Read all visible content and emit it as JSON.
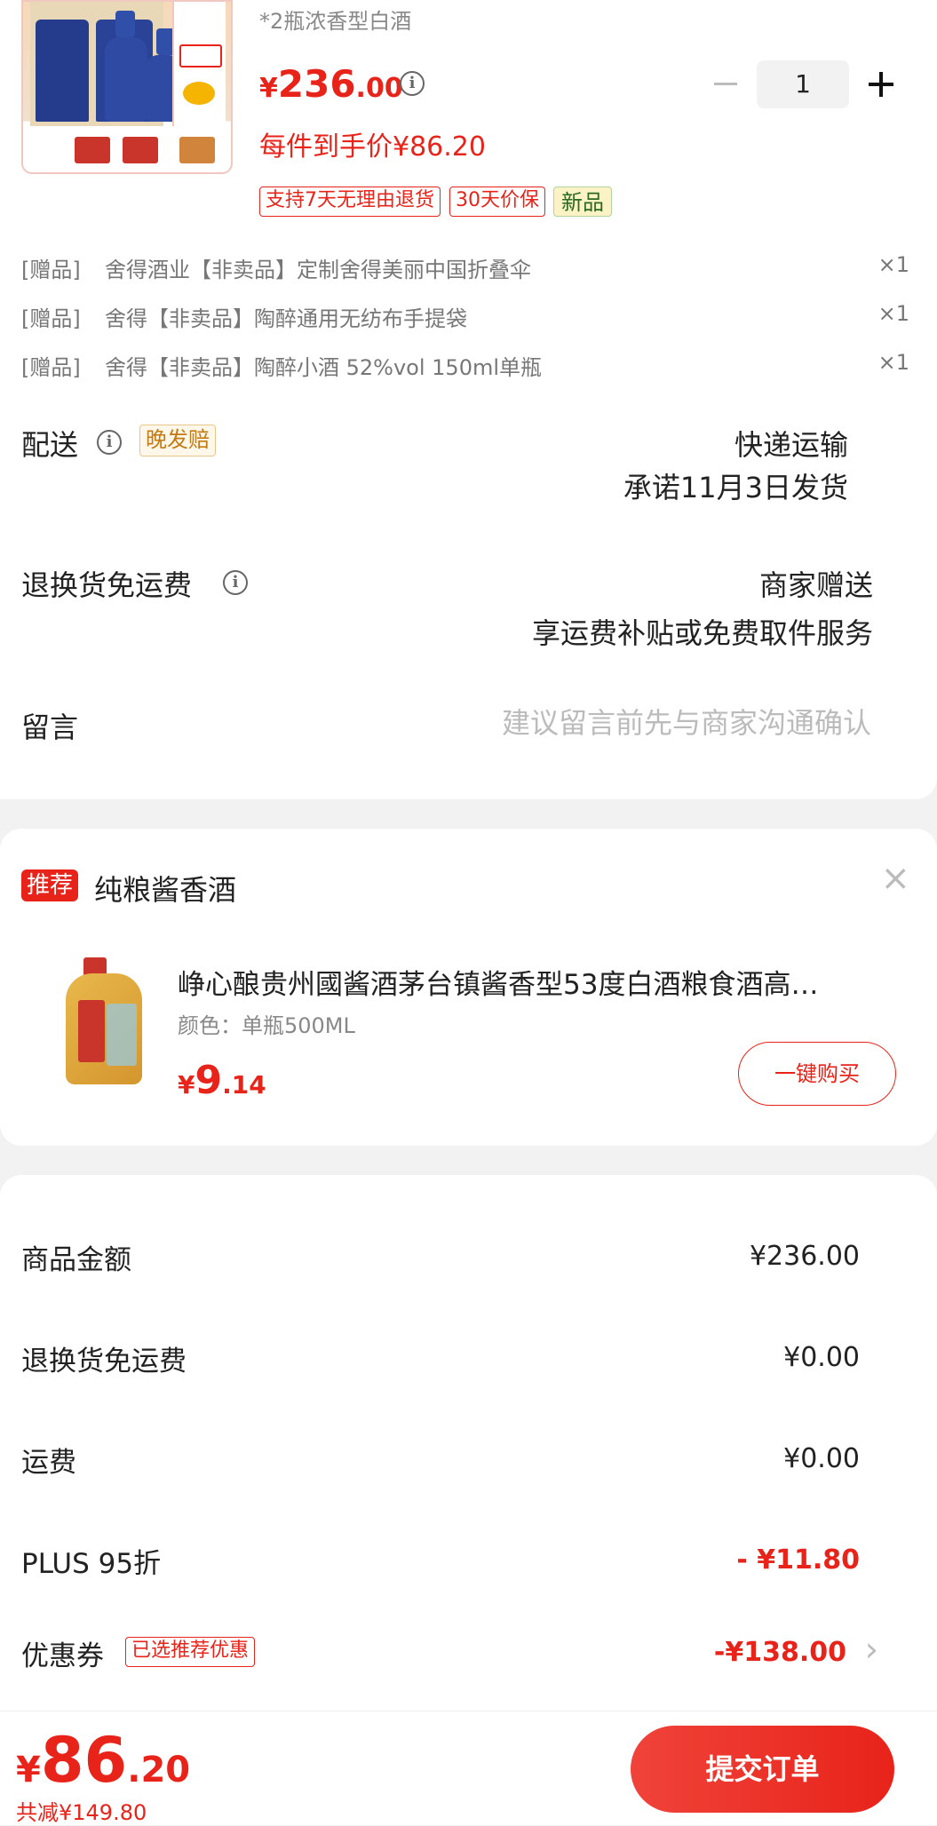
{
  "product": {
    "spec": "*2瓶浓香型白酒",
    "price_symbol": "¥",
    "price_int": "236",
    "price_dec": ".00",
    "final_price_text": "每件到手价¥86.20",
    "quantity": "1",
    "tags": [
      "支持7天无理由退货",
      "30天价保",
      "新品"
    ]
  },
  "gifts": [
    {
      "mark": "[赠品]",
      "name": "舍得酒业【非卖品】定制舍得美丽中国折叠伞",
      "qty": "×1"
    },
    {
      "mark": "[赠品]",
      "name": "舍得【非卖品】陶醉通用无纺布手提袋",
      "qty": "×1"
    },
    {
      "mark": "[赠品]",
      "name": "舍得【非卖品】陶醉小酒  52%vol 150ml单瓶",
      "qty": "×1"
    }
  ],
  "delivery": {
    "label": "配送",
    "badge": "晚发赔",
    "method": "快递运输",
    "promise": "承诺11月3日发货"
  },
  "return_shipping": {
    "label": "退换货免运费",
    "value": "商家赠送",
    "desc": "享运费补贴或免费取件服务"
  },
  "message": {
    "label": "留言",
    "placeholder": "建议留言前先与商家沟通确认"
  },
  "recommend": {
    "badge": "推荐",
    "title": "纯粮酱香酒",
    "close": "×",
    "item_title": "峥心酿贵州國酱酒茅台镇酱香型53度白酒粮食酒高…",
    "item_spec": "颜色：单瓶500ML",
    "price_symbol": "¥",
    "price_int": "9",
    "price_dec": ".14",
    "buy_button": "一键购买"
  },
  "summary": [
    {
      "label": "商品金额",
      "value": "¥236.00",
      "color": "#222222"
    },
    {
      "label": "退换货免运费",
      "value": "¥0.00",
      "color": "#222222"
    },
    {
      "label": "运费",
      "value": "¥0.00",
      "color": "#222222"
    },
    {
      "label": "PLUS 95折",
      "value": "- ¥11.80",
      "color": "#e8231a"
    }
  ],
  "coupon": {
    "label": "优惠券",
    "badge": "已选推荐优惠",
    "value": "-¥138.00",
    "chevron": "›"
  },
  "footer": {
    "price_symbol": "¥",
    "price_int": "86",
    "price_dec": ".20",
    "discount_text": "共减¥149.80",
    "submit": "提交订单"
  },
  "colors": {
    "accent": "#e8231a",
    "bg": "#f2f2f2"
  }
}
